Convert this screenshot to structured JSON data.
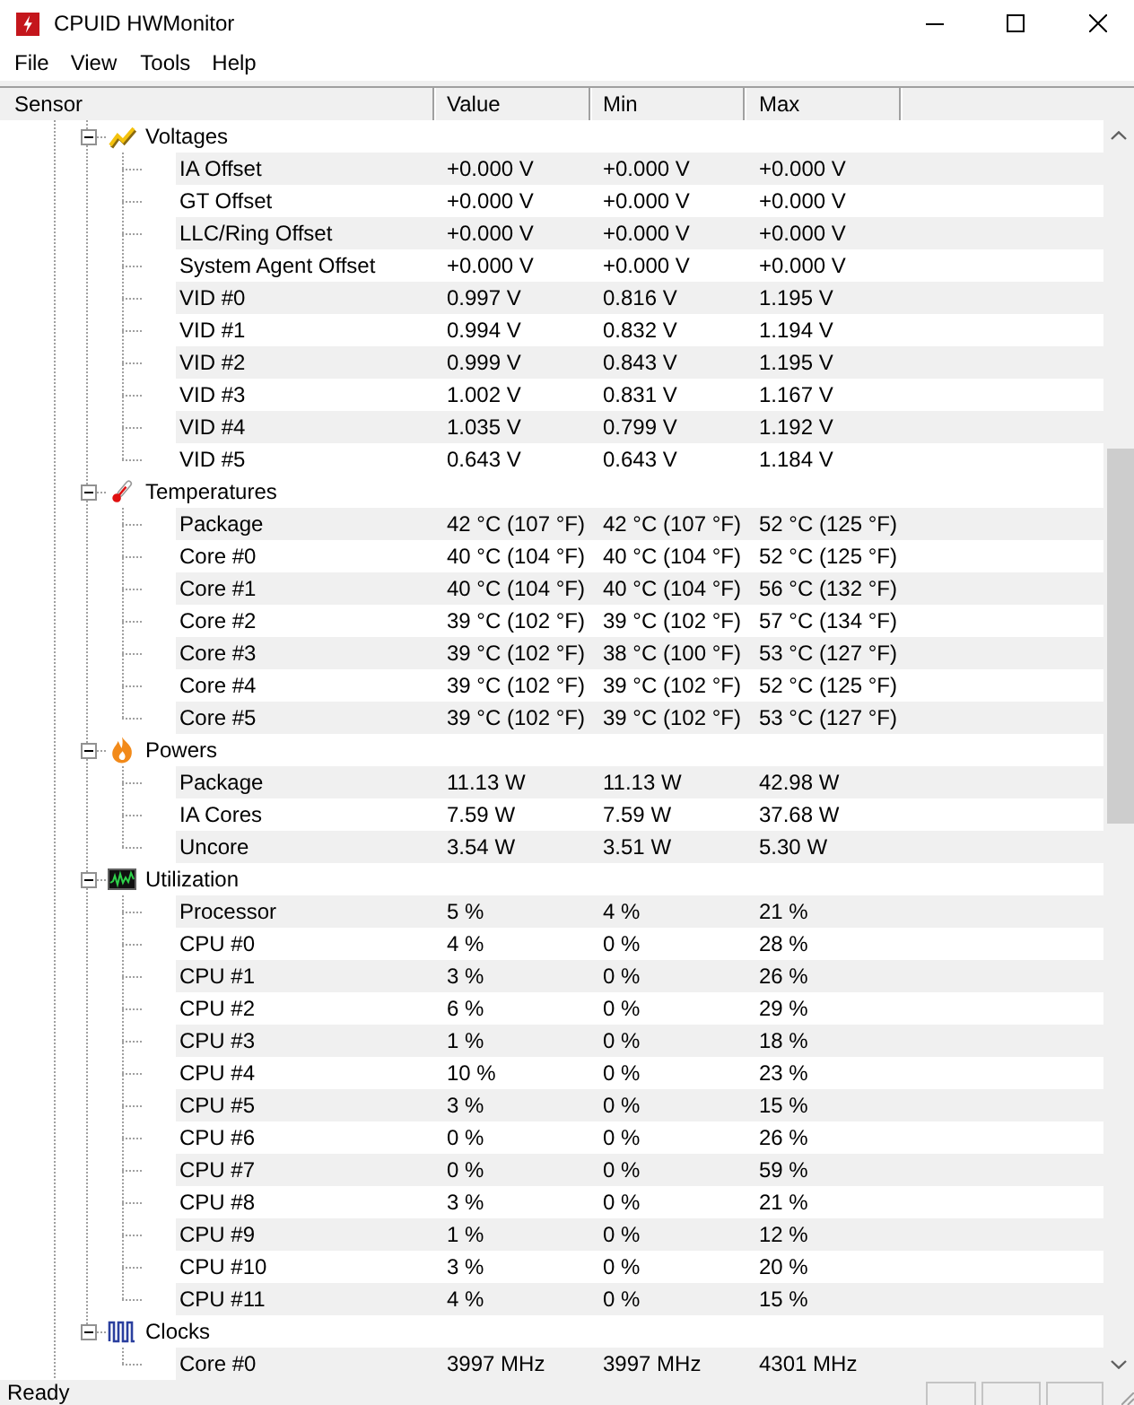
{
  "window": {
    "title": "CPUID HWMonitor"
  },
  "menu": [
    "File",
    "View",
    "Tools",
    "Help"
  ],
  "table": {
    "columns": [
      "Sensor",
      "Value",
      "Min",
      "Max"
    ],
    "groups": [
      {
        "name": "Voltages",
        "kind": "voltages",
        "expanded": true,
        "children": [
          {
            "name": "IA Offset",
            "value": "+0.000 V",
            "min": "+0.000 V",
            "max": "+0.000 V"
          },
          {
            "name": "GT Offset",
            "value": "+0.000 V",
            "min": "+0.000 V",
            "max": "+0.000 V"
          },
          {
            "name": "LLC/Ring Offset",
            "value": "+0.000 V",
            "min": "+0.000 V",
            "max": "+0.000 V"
          },
          {
            "name": "System Agent Offset",
            "value": "+0.000 V",
            "min": "+0.000 V",
            "max": "+0.000 V"
          },
          {
            "name": "VID #0",
            "value": "0.997 V",
            "min": "0.816 V",
            "max": "1.195 V"
          },
          {
            "name": "VID #1",
            "value": "0.994 V",
            "min": "0.832 V",
            "max": "1.194 V"
          },
          {
            "name": "VID #2",
            "value": "0.999 V",
            "min": "0.843 V",
            "max": "1.195 V"
          },
          {
            "name": "VID #3",
            "value": "1.002 V",
            "min": "0.831 V",
            "max": "1.167 V"
          },
          {
            "name": "VID #4",
            "value": "1.035 V",
            "min": "0.799 V",
            "max": "1.192 V"
          },
          {
            "name": "VID #5",
            "value": "0.643 V",
            "min": "0.643 V",
            "max": "1.184 V"
          }
        ]
      },
      {
        "name": "Temperatures",
        "kind": "temperatures",
        "expanded": true,
        "children": [
          {
            "name": "Package",
            "value": "42 °C (107 °F)",
            "min": "42 °C (107 °F)",
            "max": "52 °C (125 °F)"
          },
          {
            "name": "Core #0",
            "value": "40 °C (104 °F)",
            "min": "40 °C (104 °F)",
            "max": "52 °C (125 °F)"
          },
          {
            "name": "Core #1",
            "value": "40 °C (104 °F)",
            "min": "40 °C (104 °F)",
            "max": "56 °C (132 °F)"
          },
          {
            "name": "Core #2",
            "value": "39 °C (102 °F)",
            "min": "39 °C (102 °F)",
            "max": "57 °C (134 °F)"
          },
          {
            "name": "Core #3",
            "value": "39 °C (102 °F)",
            "min": "38 °C (100 °F)",
            "max": "53 °C (127 °F)"
          },
          {
            "name": "Core #4",
            "value": "39 °C (102 °F)",
            "min": "39 °C (102 °F)",
            "max": "52 °C (125 °F)"
          },
          {
            "name": "Core #5",
            "value": "39 °C (102 °F)",
            "min": "39 °C (102 °F)",
            "max": "53 °C (127 °F)"
          }
        ]
      },
      {
        "name": "Powers",
        "kind": "powers",
        "expanded": true,
        "children": [
          {
            "name": "Package",
            "value": "11.13 W",
            "min": "11.13 W",
            "max": "42.98 W"
          },
          {
            "name": "IA Cores",
            "value": "7.59 W",
            "min": "7.59 W",
            "max": "37.68 W"
          },
          {
            "name": "Uncore",
            "value": "3.54 W",
            "min": "3.51 W",
            "max": "5.30 W"
          }
        ]
      },
      {
        "name": "Utilization",
        "kind": "utilization",
        "expanded": true,
        "children": [
          {
            "name": "Processor",
            "value": "5 %",
            "min": "4 %",
            "max": "21 %"
          },
          {
            "name": "CPU #0",
            "value": "4 %",
            "min": "0 %",
            "max": "28 %"
          },
          {
            "name": "CPU #1",
            "value": "3 %",
            "min": "0 %",
            "max": "26 %"
          },
          {
            "name": "CPU #2",
            "value": "6 %",
            "min": "0 %",
            "max": "29 %"
          },
          {
            "name": "CPU #3",
            "value": "1 %",
            "min": "0 %",
            "max": "18 %"
          },
          {
            "name": "CPU #4",
            "value": "10 %",
            "min": "0 %",
            "max": "23 %"
          },
          {
            "name": "CPU #5",
            "value": "3 %",
            "min": "0 %",
            "max": "15 %"
          },
          {
            "name": "CPU #6",
            "value": "0 %",
            "min": "0 %",
            "max": "26 %"
          },
          {
            "name": "CPU #7",
            "value": "0 %",
            "min": "0 %",
            "max": "59 %"
          },
          {
            "name": "CPU #8",
            "value": "3 %",
            "min": "0 %",
            "max": "21 %"
          },
          {
            "name": "CPU #9",
            "value": "1 %",
            "min": "0 %",
            "max": "12 %"
          },
          {
            "name": "CPU #10",
            "value": "3 %",
            "min": "0 %",
            "max": "20 %"
          },
          {
            "name": "CPU #11",
            "value": "4 %",
            "min": "0 %",
            "max": "15 %"
          }
        ]
      },
      {
        "name": "Clocks",
        "kind": "clocks",
        "expanded": true,
        "children": [
          {
            "name": "Core #0",
            "value": "3997 MHz",
            "min": "3997 MHz",
            "max": "4301 MHz"
          }
        ]
      }
    ]
  },
  "status_bar": {
    "text": "Ready"
  }
}
